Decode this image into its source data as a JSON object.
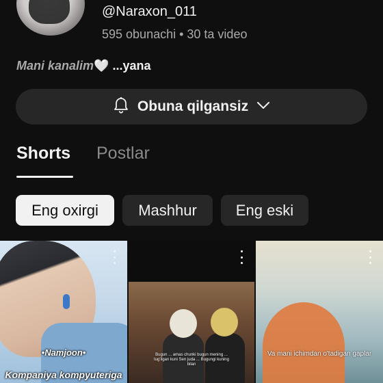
{
  "channel": {
    "handle": "@Naraxon_011",
    "stats": "595 obunachi • 30 ta video",
    "description_main": "Mani kanalim",
    "description_heart": "🤍",
    "description_more": " ...yana"
  },
  "subscribe": {
    "label": "Obuna qilgansiz",
    "bell_icon": "bell-icon",
    "chevron_icon": "chevron-down-icon"
  },
  "tabs": [
    {
      "label": "Shorts",
      "active": true
    },
    {
      "label": "Postlar",
      "active": false
    }
  ],
  "chips": [
    {
      "label": "Eng oxirgi",
      "selected": true
    },
    {
      "label": "Mashhur",
      "selected": false
    },
    {
      "label": "Eng eski",
      "selected": false
    }
  ],
  "shorts": [
    {
      "caption_a": "•Namjoon•",
      "caption_b": "Kompaniya kompyuteriga"
    },
    {
      "caption": "Bugun ... amas chunki bugun mening ... tug'ilgan kuni Sen juda ... Bugungi kuning bilan"
    },
    {
      "caption": "Va mani ichimdan o'tadigan gaplar"
    }
  ]
}
